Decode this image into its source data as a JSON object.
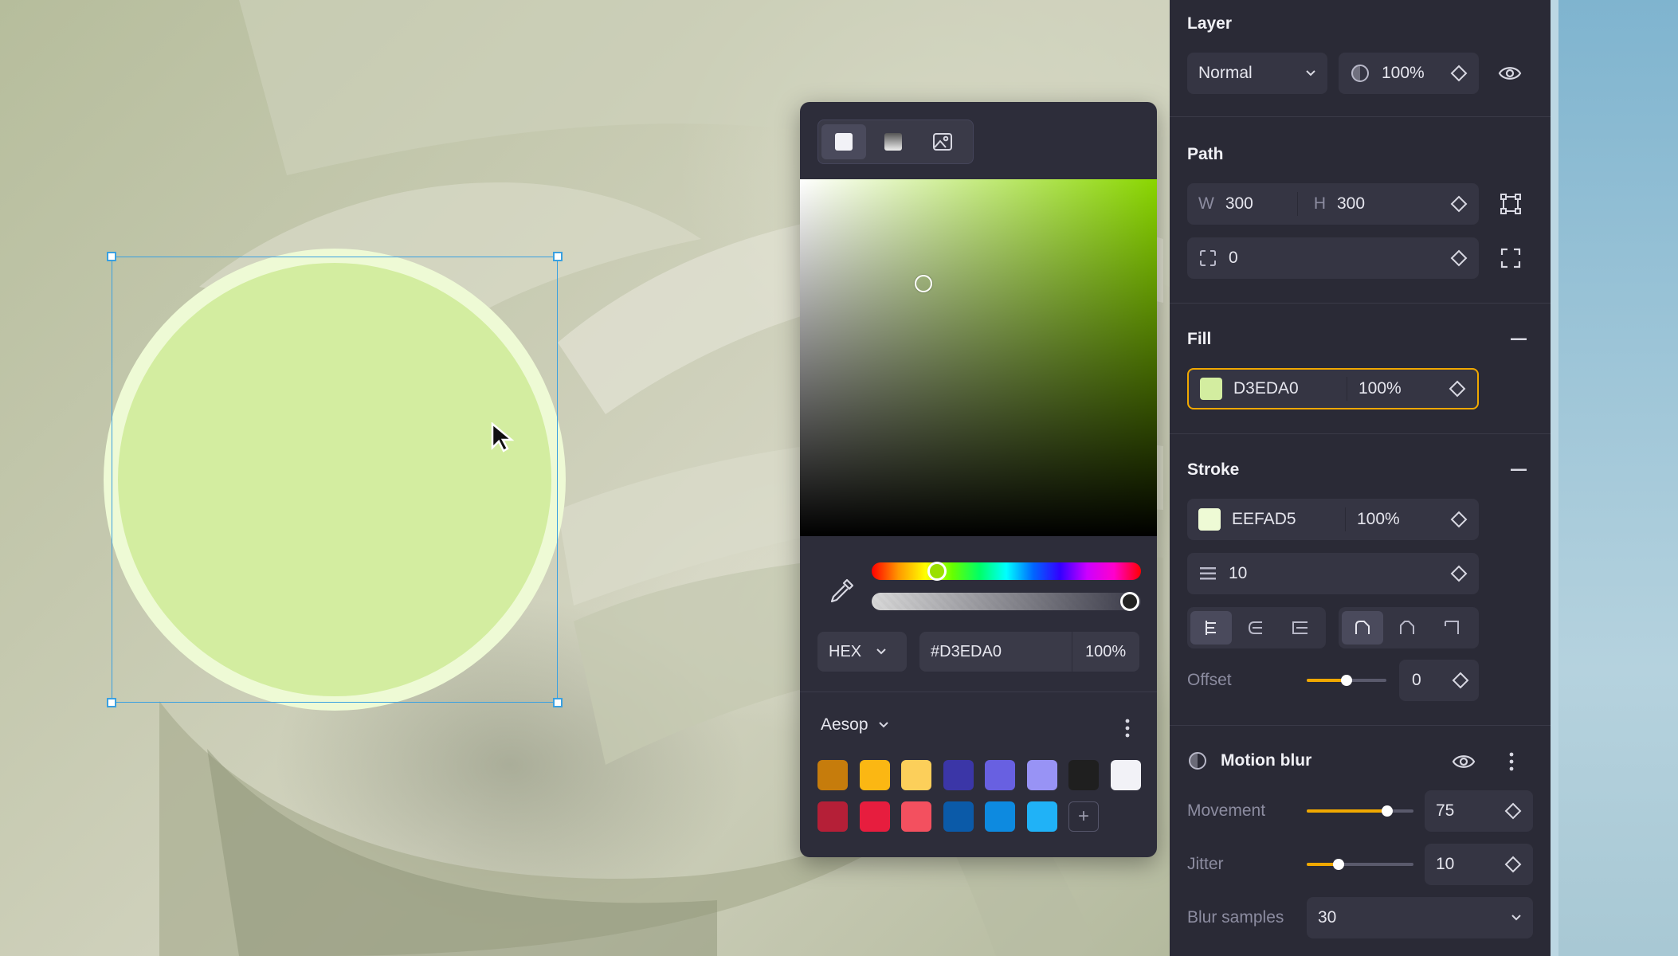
{
  "picker": {
    "modes": [
      "solid-icon",
      "gradient-icon",
      "image-icon"
    ],
    "format": "HEX",
    "hex_value": "#D3EDA0",
    "opacity": "100%",
    "hue": 0.22,
    "alpha": 1.0,
    "palette_name": "Aesop",
    "swatches_row1": [
      "#c67c0c",
      "#fbb713",
      "#fccf5a",
      "#3b36a7",
      "#6860e1",
      "#9893f5",
      "#1f1f1f",
      "#f2f2f7"
    ],
    "swatches_row2": [
      "#b51f37",
      "#e71d3e",
      "#f3505f",
      "#0b5aa8",
      "#0d8ae0",
      "#20b2f7"
    ],
    "add_label": "+"
  },
  "panel": {
    "layer": {
      "title": "Layer",
      "blend_mode": "Normal",
      "opacity": "100%"
    },
    "path": {
      "title": "Path",
      "w_label": "W",
      "w_value": "300",
      "h_label": "H",
      "h_value": "300",
      "radius": "0"
    },
    "fill": {
      "title": "Fill",
      "color": "#d3eda0",
      "hex": "D3EDA0",
      "opacity": "100%"
    },
    "stroke": {
      "title": "Stroke",
      "color": "#eefad5",
      "hex": "EEFAD5",
      "opacity": "100%",
      "width": "10",
      "offset_label": "Offset",
      "offset_value": "0",
      "offset_level": 0.5
    },
    "motion_blur": {
      "title": "Motion blur",
      "movement_label": "Movement",
      "movement_value": "75",
      "movement_level": 0.75,
      "jitter_label": "Jitter",
      "jitter_value": "10",
      "jitter_level": 0.3,
      "samples_label": "Blur samples",
      "samples_value": "30"
    }
  },
  "colors": {
    "accent": "#f0a800",
    "selection": "#3aa0e0",
    "fill": "#d3eda0",
    "stroke": "#eefad5"
  }
}
